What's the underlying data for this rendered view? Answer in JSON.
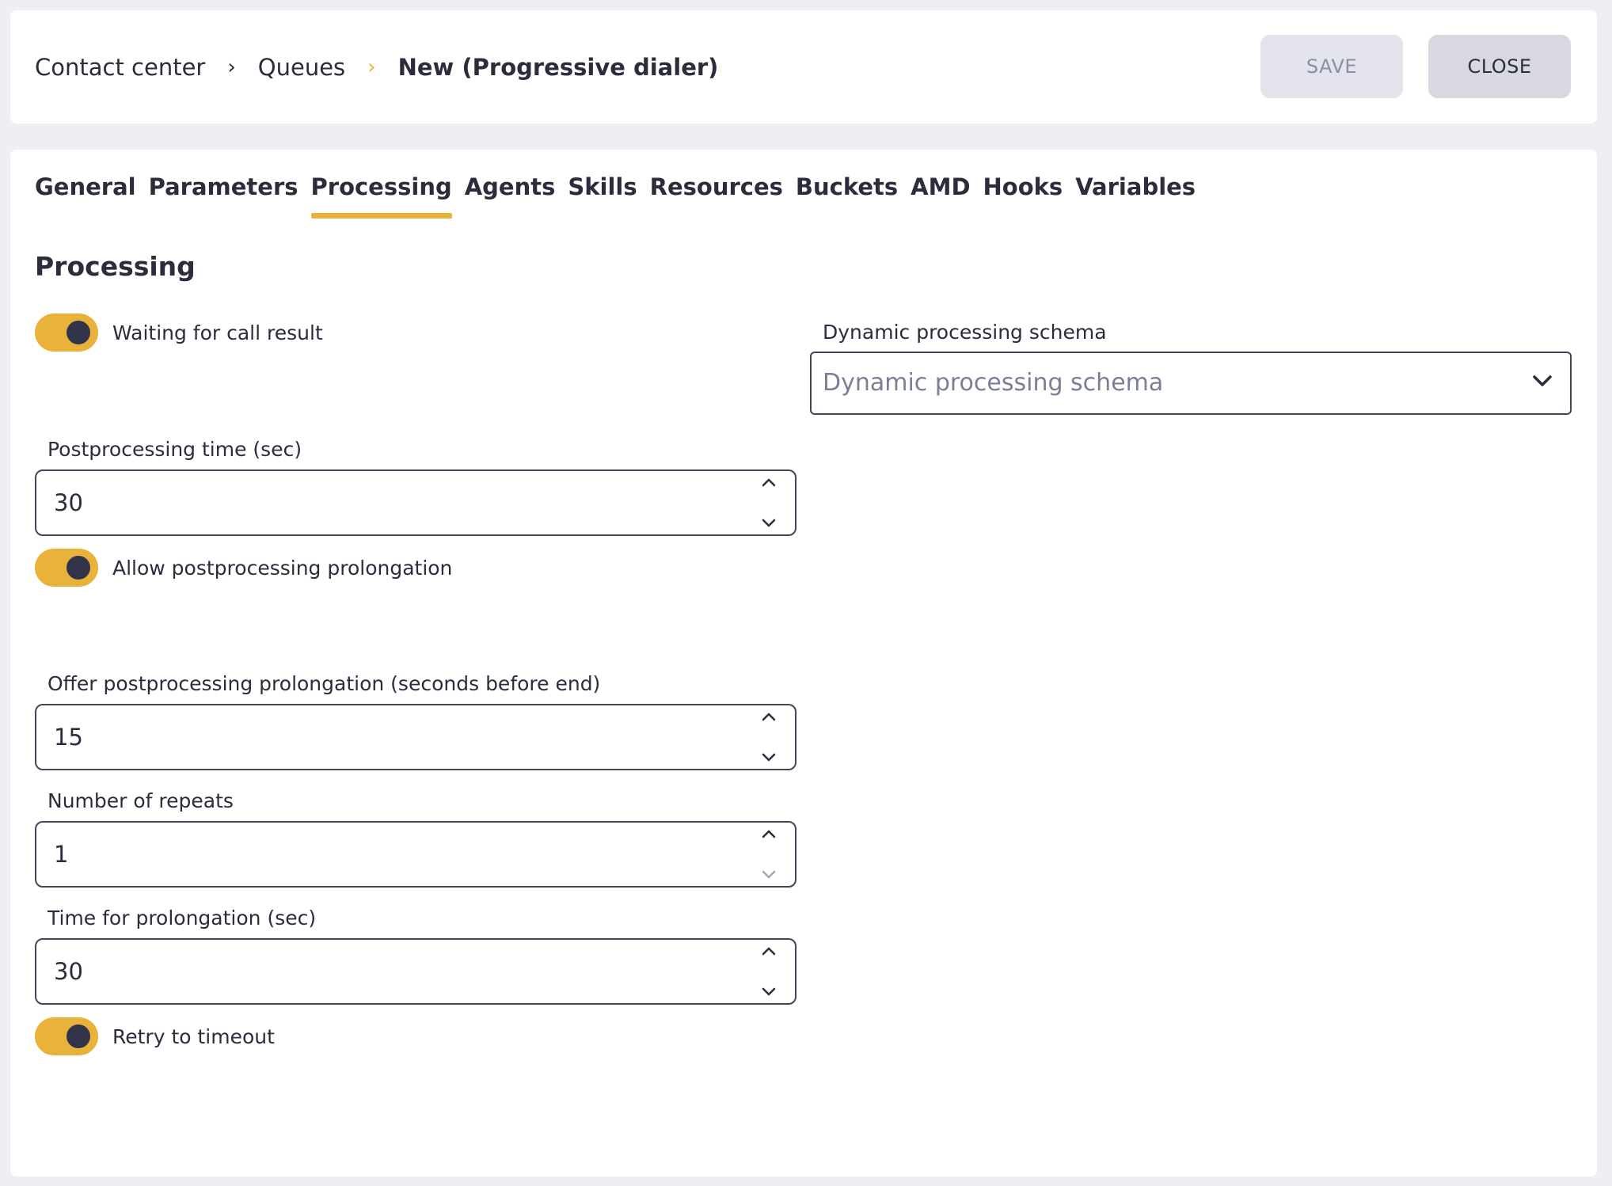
{
  "breadcrumb": [
    "Contact center",
    "Queues",
    "New (Progressive dialer)"
  ],
  "header": {
    "save_label": "SAVE",
    "close_label": "CLOSE"
  },
  "tabs": [
    "General",
    "Parameters",
    "Processing",
    "Agents",
    "Skills",
    "Resources",
    "Buckets",
    "AMD",
    "Hooks",
    "Variables"
  ],
  "active_tab": "Processing",
  "section_title": "Processing",
  "toggles": {
    "waiting": {
      "label": "Waiting for call result",
      "on": true
    },
    "allow_prolongation": {
      "label": "Allow postprocessing prolongation",
      "on": true
    },
    "retry": {
      "label": "Retry to timeout",
      "on": true
    }
  },
  "fields": {
    "postprocessing_time": {
      "label": "Postprocessing time (sec)",
      "value": "30"
    },
    "offer_prolongation": {
      "label": "Offer postprocessing prolongation (seconds before end)",
      "value": "15"
    },
    "repeats": {
      "label": "Number of repeats",
      "value": "1"
    },
    "prolongation_time": {
      "label": "Time for prolongation (sec)",
      "value": "30"
    }
  },
  "schema": {
    "label": "Dynamic processing schema",
    "placeholder": "Dynamic processing schema"
  },
  "colors": {
    "accent": "#e9b33b",
    "knob": "#32344a",
    "text": "#2b2d3c"
  }
}
